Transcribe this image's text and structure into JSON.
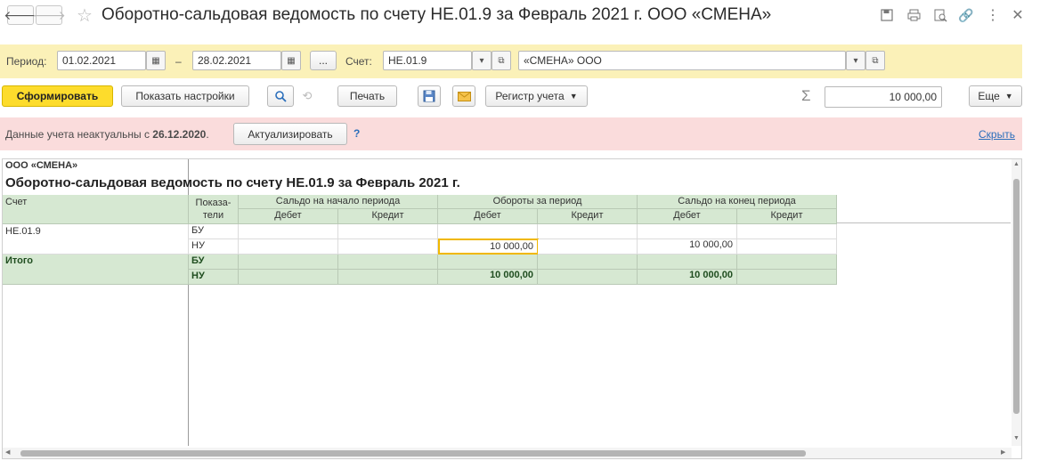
{
  "window": {
    "title": "Оборотно-сальдовая ведомость по счету НЕ.01.9 за Февраль 2021 г. ООО «СМЕНА»"
  },
  "period": {
    "label": "Период:",
    "from": "01.02.2021",
    "dash": "–",
    "to": "28.02.2021",
    "more": "...",
    "account_label": "Счет:",
    "account": "НЕ.01.9",
    "organization": "«СМЕНА» ООО"
  },
  "toolbar": {
    "generate": "Сформировать",
    "show_settings": "Показать настройки",
    "print": "Печать",
    "register": "Регистр учета",
    "sum": "10 000,00",
    "more": "Еще"
  },
  "alert": {
    "text": "Данные учета неактуальны с ",
    "date": "26.12.2020",
    "dot": ".",
    "refresh": "Актуализировать",
    "help": "?",
    "hide": "Скрыть"
  },
  "report": {
    "org": "ООО «СМЕНА»",
    "title": "Оборотно-сальдовая ведомость по счету НЕ.01.9 за Февраль 2021 г.",
    "headers": {
      "account": "Счет",
      "indicators_line1": "Показа-",
      "indicators_line2": "тели",
      "opening": "Сальдо на начало периода",
      "turnover": "Обороты за период",
      "closing": "Сальдо на конец периода",
      "debit": "Дебет",
      "credit": "Кредит"
    },
    "rows": [
      {
        "account": "НЕ.01.9",
        "indicator": "БУ",
        "values": [
          "",
          "",
          "",
          "",
          "",
          ""
        ]
      },
      {
        "account": "",
        "indicator": "НУ",
        "values": [
          "",
          "",
          "10 000,00",
          "",
          "10 000,00",
          ""
        ]
      }
    ],
    "totals": {
      "label": "Итого",
      "rows": [
        {
          "indicator": "БУ",
          "values": [
            "",
            "",
            "",
            "",
            "",
            ""
          ]
        },
        {
          "indicator": "НУ",
          "values": [
            "",
            "",
            "10 000,00",
            "",
            "10 000,00",
            ""
          ]
        }
      ]
    }
  },
  "icons": {
    "back": "arrow-left-icon",
    "forward": "arrow-right-icon",
    "star": "star-icon",
    "save": "floppy-icon",
    "print": "printer-icon",
    "preview": "preview-icon",
    "link": "link-icon",
    "menu": "kebab-icon",
    "close": "close-icon",
    "search": "search-icon",
    "sigma": "sigma-icon",
    "mail": "envelope-icon"
  },
  "colors": {
    "period_bar": "#fbf1b8",
    "alert_bar": "#fadcdc",
    "primary_button": "#fddc2c",
    "header_green": "#d6e8d2",
    "selection": "#f0b800"
  }
}
